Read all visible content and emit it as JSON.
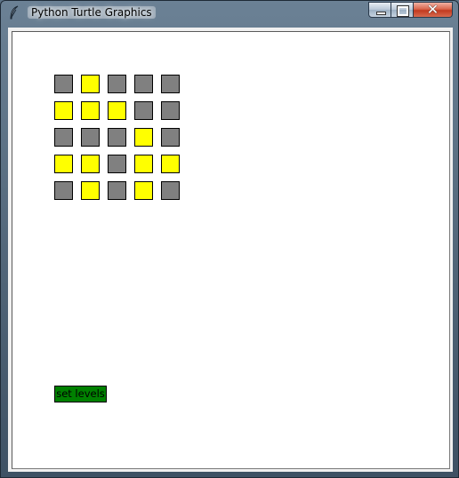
{
  "window": {
    "title": "Python Turtle Graphics",
    "icon": "feather-icon",
    "controls": [
      "minimize-icon",
      "maximize-icon",
      "close-icon"
    ]
  },
  "colors": {
    "on": "#ffff00",
    "off": "#808080",
    "button": "#008000"
  },
  "grid": {
    "cells": [
      [
        "off",
        "on",
        "off",
        "off",
        "off"
      ],
      [
        "on",
        "on",
        "on",
        "off",
        "off"
      ],
      [
        "off",
        "off",
        "off",
        "on",
        "off"
      ],
      [
        "on",
        "on",
        "off",
        "on",
        "on"
      ],
      [
        "off",
        "on",
        "off",
        "on",
        "off"
      ]
    ]
  },
  "button": {
    "label": "set levels"
  }
}
